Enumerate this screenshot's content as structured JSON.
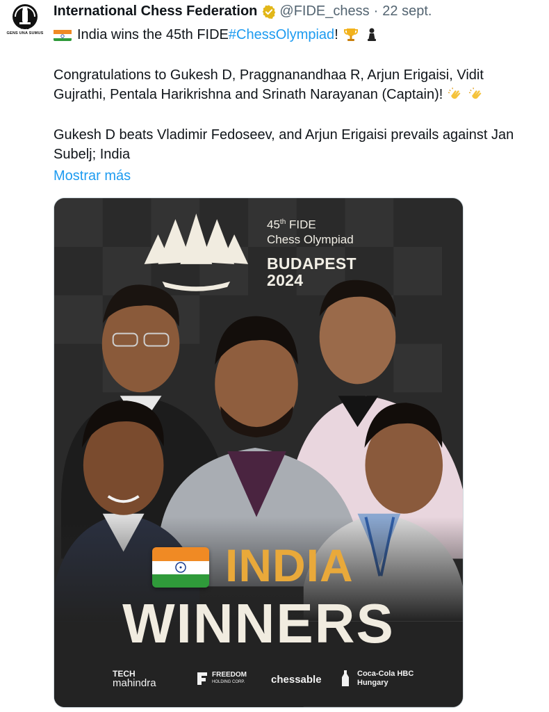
{
  "tweet": {
    "author_name": "International Chess Federation",
    "handle": "@FIDE_chess",
    "separator": "·",
    "date": "22 sept.",
    "avatar_text": "GENS UNA SUMUS",
    "line1_text": "India wins the 45th FIDE ",
    "hashtag": "#ChessOlympiad",
    "line1_suffix": "!",
    "para2_line1": "Congratulations to Gukesh D, Praggnanandhaa R, Arjun Erigaisi, Vidit",
    "para2_line2": "Gujrathi, Pentala Harikrishna and Srinath Narayanan (Captain)!",
    "para3_line1": "Gukesh D beats Vladimir Fedoseev, and Arjun Erigaisi prevails against Jan",
    "para3_line2": "Subelj; India",
    "show_more": "Mostrar más"
  },
  "image": {
    "event_ordinal": "45",
    "event_ordinal_suffix": "th",
    "event_fide": " FIDE",
    "event_name": "Chess Olympiad",
    "city": "BUDAPEST",
    "year": "2024",
    "headline_country": "INDIA",
    "headline_result": "WINNERS",
    "sponsors": {
      "tech_top": "TECH",
      "tech_bottom": "mahindra",
      "freedom_top": "FREEDOM",
      "freedom_bottom": "HOLDING CORP.",
      "chessable": "chessable",
      "coca_top": "Coca-Cola HBC",
      "coca_bottom": "Hungary"
    }
  },
  "colors": {
    "link": "#1d9bf0",
    "muted": "#536471",
    "india_gold": "#e9a93a",
    "card_bg": "#262626"
  }
}
